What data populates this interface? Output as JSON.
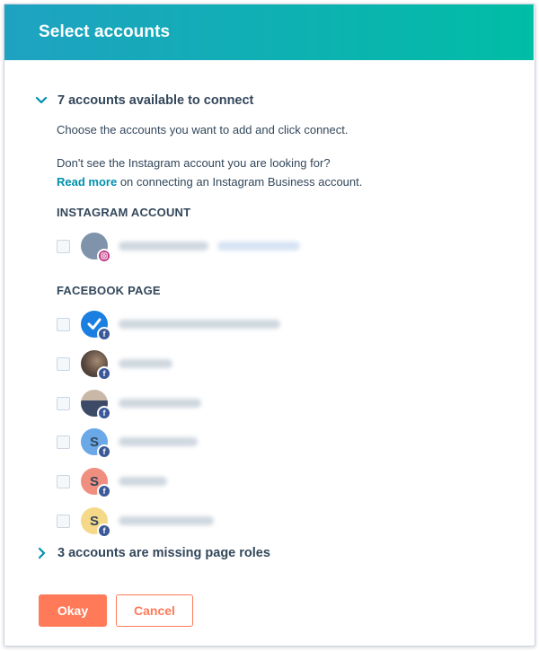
{
  "header": {
    "title": "Select accounts"
  },
  "available_section": {
    "title": "7 accounts available to connect",
    "instructions": "Choose the accounts you want to add and click connect.",
    "missing_notice": "Don't see the Instagram account you are looking for?",
    "read_more_link": "Read more",
    "read_more_suffix": " on connecting an Instagram Business account."
  },
  "instagram_group": {
    "heading": "INSTAGRAM ACCOUNT"
  },
  "facebook_group": {
    "heading": "FACEBOOK PAGE"
  },
  "facebook_accounts": [
    {
      "initial": "",
      "avatar_color": "#2d8ae8"
    },
    {
      "initial": "",
      "avatar_color": "#6b5a4e"
    },
    {
      "initial": "",
      "avatar_color": "#8a9bb0"
    },
    {
      "initial": "S",
      "avatar_color": "#6aa8e8"
    },
    {
      "initial": "S",
      "avatar_color": "#f08e80"
    },
    {
      "initial": "S",
      "avatar_color": "#f5d989"
    }
  ],
  "missing_roles_section": {
    "title": "3 accounts are missing page roles"
  },
  "footer": {
    "okay_label": "Okay",
    "cancel_label": "Cancel"
  },
  "colors": {
    "accent": "#ff7a59",
    "link": "#0091ae",
    "header_start": "#1fa2c2",
    "header_end": "#00bda5"
  }
}
